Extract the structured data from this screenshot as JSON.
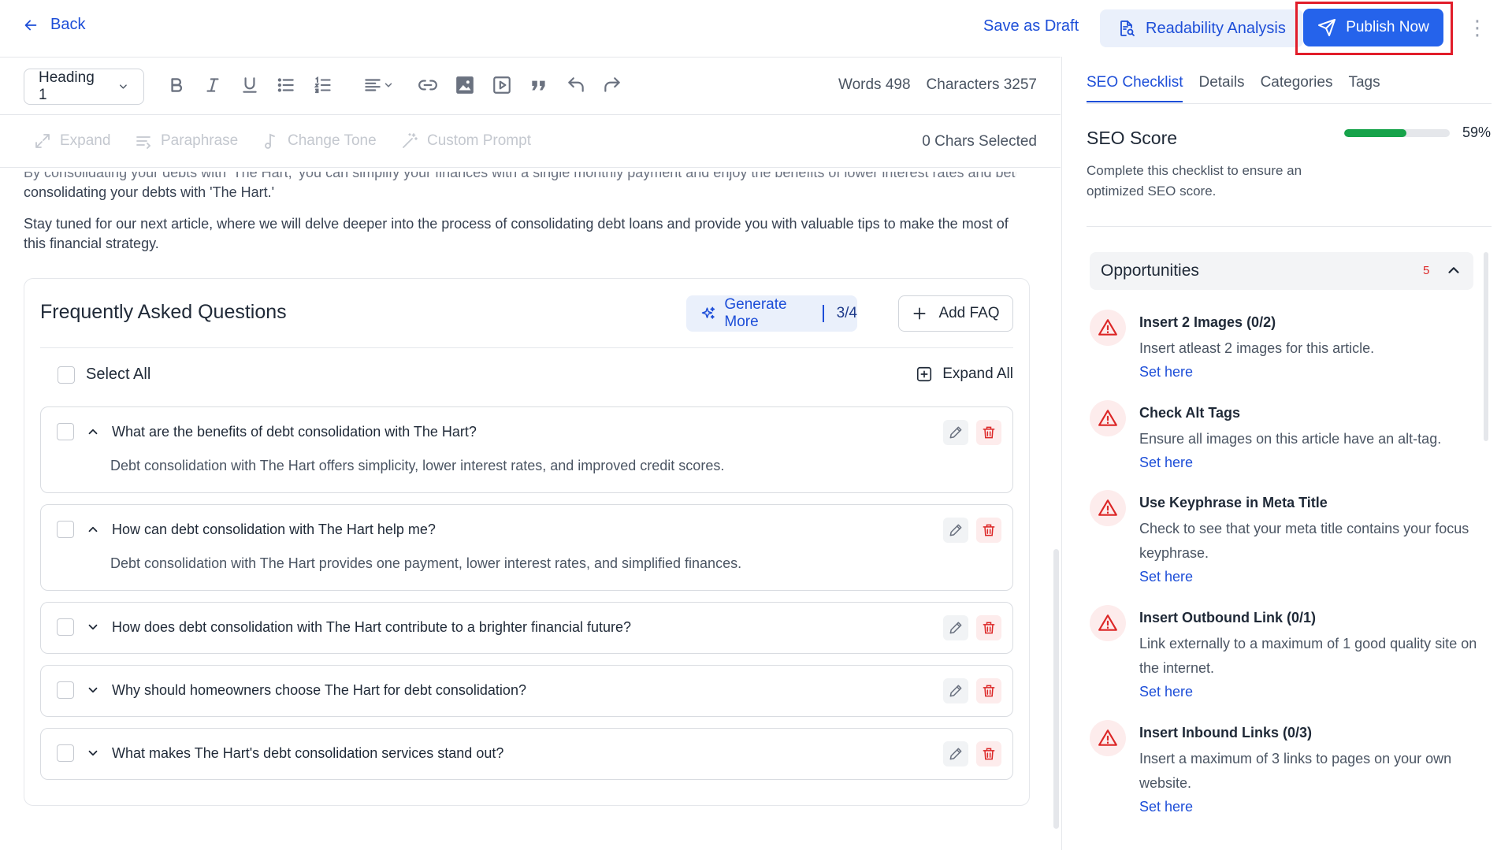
{
  "header": {
    "back_label": "Back",
    "save_draft_label": "Save as Draft",
    "readability_label": "Readability Analysis",
    "publish_label": "Publish Now",
    "more_label": "⋮"
  },
  "toolbar": {
    "heading_value": "Heading 1",
    "words_label": "Words 498",
    "characters_label": "Characters 3257"
  },
  "ai_toolbar": {
    "expand_label": "Expand",
    "paraphrase_label": "Paraphrase",
    "tone_label": "Change Tone",
    "custom_label": "Custom Prompt",
    "selected_label": "0 Chars Selected"
  },
  "content": {
    "clipped_line": "By consolidating your debts with 'The Hart,' you can simplify your finances with a single monthly payment and enjoy the benefits of lower interest rates and better credit, effectively",
    "para1_end": "consolidating your debts with 'The Hart.'",
    "para2": "Stay tuned for our next article, where we will delve deeper into the process of consolidating debt loans and provide you with valuable tips to make the most of this financial strategy."
  },
  "faq": {
    "title": "Frequently Asked Questions",
    "generate_label": "Generate More",
    "generate_count": "3/4",
    "add_label": "Add FAQ",
    "select_all_label": "Select All",
    "expand_all_label": "Expand All",
    "items": [
      {
        "question": "What are the benefits of debt consolidation with The Hart?",
        "answer": "Debt consolidation with The Hart offers simplicity, lower interest rates, and improved credit scores.",
        "expanded": true
      },
      {
        "question": "How can debt consolidation with The Hart help me?",
        "answer": "Debt consolidation with The Hart provides one payment, lower interest rates, and simplified finances.",
        "expanded": true
      },
      {
        "question": "How does debt consolidation with The Hart contribute to a brighter financial future?",
        "answer": "",
        "expanded": false
      },
      {
        "question": "Why should homeowners choose The Hart for debt consolidation?",
        "answer": "",
        "expanded": false
      },
      {
        "question": "What makes The Hart's debt consolidation services stand out?",
        "answer": "",
        "expanded": false
      }
    ]
  },
  "panel": {
    "tabs": [
      "SEO Checklist",
      "Details",
      "Categories",
      "Tags"
    ],
    "seo_label": "SEO Score",
    "seo_percent_label": "59%",
    "seo_score": 0.59,
    "seo_desc": "Complete this checklist to ensure an optimized SEO score.",
    "opportunities_label": "Opportunities",
    "opportunities_count": "5",
    "items": [
      {
        "name": "Insert 2 Images (0/2)",
        "text": "Insert atleast 2 images for this article.",
        "link": "Set here"
      },
      {
        "name": "Check Alt Tags",
        "text": "Ensure all images on this article have an alt-tag.",
        "link": "Set here"
      },
      {
        "name": "Use Keyphrase in Meta Title",
        "text": "Check to see that your meta title contains your focus keyphrase.",
        "link": "Set here"
      },
      {
        "name": "Insert Outbound Link (0/1)",
        "text": "Link externally to a maximum of 1 good quality site on the internet.",
        "link": "Set here"
      },
      {
        "name": "Insert Inbound Links (0/3)",
        "text": "Insert a maximum of 3 links to pages on your own website.",
        "link": "Set here"
      }
    ]
  },
  "colors": {
    "accent": "#2563eb",
    "accent_text": "#1d4ed8",
    "danger": "#dc2626",
    "success": "#16a34a",
    "highlight_frame": "#e11d2a"
  }
}
